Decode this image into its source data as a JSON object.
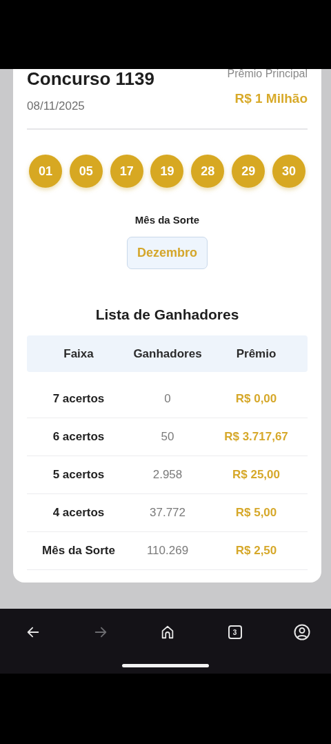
{
  "draw": {
    "title": "Concurso 1139",
    "date": "08/11/2025",
    "prize_label": "Prêmio Principal",
    "prize": "R$ 1 Milhão"
  },
  "numbers": [
    "01",
    "05",
    "17",
    "19",
    "28",
    "29",
    "30"
  ],
  "lucky_month": {
    "label": "Mês da Sorte",
    "value": "Dezembro"
  },
  "winners": {
    "title": "Lista de Ganhadores",
    "columns": [
      "Faixa",
      "Ganhadores",
      "Prêmio"
    ],
    "rows": [
      {
        "tier": "7 acertos",
        "winners": "0",
        "prize": "R$ 0,00"
      },
      {
        "tier": "6 acertos",
        "winners": "50",
        "prize": "R$ 3.717,67"
      },
      {
        "tier": "5 acertos",
        "winners": "2.958",
        "prize": "R$ 25,00"
      },
      {
        "tier": "4 acertos",
        "winners": "37.772",
        "prize": "R$ 5,00"
      },
      {
        "tier": "Mês da Sorte",
        "winners": "110.269",
        "prize": "R$ 2,50"
      }
    ]
  },
  "browser_nav": [
    {
      "kind": "back",
      "disabled": false
    },
    {
      "kind": "forward",
      "disabled": true
    },
    {
      "kind": "home",
      "disabled": false
    },
    {
      "kind": "tabs",
      "disabled": false,
      "count": "3"
    },
    {
      "kind": "account",
      "disabled": false
    }
  ]
}
